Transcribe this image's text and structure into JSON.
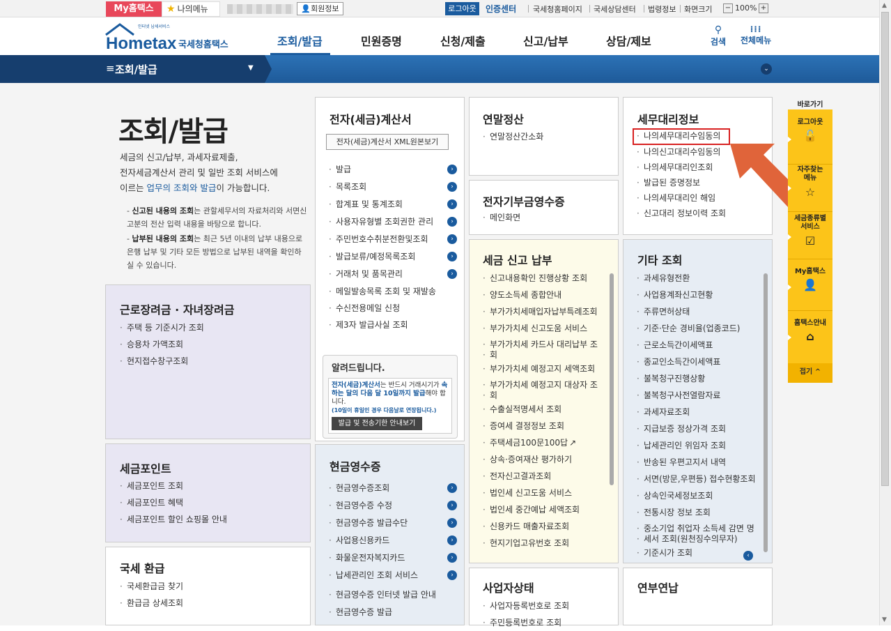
{
  "topbar": {
    "my_hometax": "My홈택스",
    "my_menu": "나의메뉴",
    "user_info": "회원정보",
    "logout": "로그아웃",
    "cert_center": "인증센터",
    "links": [
      "국세청홈페이지",
      "국세상담센터",
      "법령정보"
    ],
    "zoom_label": "화면크기",
    "zoom_minus": "−",
    "zoom_value": "100%",
    "zoom_plus": "+"
  },
  "header": {
    "logo_text": "Hometax",
    "logo_sub": "국세청홈택스",
    "logo_tagline": "인터넷 납세서비스",
    "nav": [
      "조회/발급",
      "민원증명",
      "신청/제출",
      "신고/납부",
      "상담/제보"
    ],
    "search_label": "검색",
    "allmenu_label": "전체메뉴"
  },
  "subbar": {
    "title": "조회/발급"
  },
  "intro": {
    "title": "조회/발급",
    "text1": "세금의 신고/납부, 과세자료제출,",
    "text2": "전자세금계산서 관리 및 일반 조회 서비스에",
    "text3_pre": "이르는 ",
    "text3_hl": "업무의 조회와 발급",
    "text3_post": "이 가능합니다.",
    "note1_bold": "신고된 내용의 조회",
    "note1_rest": "는 관할세무서의 자료처리와 서면신고분의 전산 입력 내용을 바탕으로 합니다.",
    "note2_bold": "납부된 내용의 조회",
    "note2_rest": "는 최근 5년 이내의 납부 내용으로 은행 납부 및 기타 모든 방법으로 납부된 내역을 확인하실 수 있습니다."
  },
  "boxes": {
    "geunro": {
      "title": "근로장려금 · 자녀장려금",
      "items": [
        "주택 등 기준시가 조회",
        "승용차 가액조회",
        "현지접수창구조회"
      ]
    },
    "point": {
      "title": "세금포인트",
      "items": [
        "세금포인트 조회",
        "세금포인트 혜택",
        "세금포인트 할인 쇼핑몰 안내"
      ]
    },
    "refund": {
      "title": "국세 환급",
      "items": [
        "국세환급금 찾기",
        "환급금 상세조회"
      ]
    },
    "einvoice": {
      "title": "전자(세금)계산서",
      "xml_button": "전자(세금)계산서 XML원본보기",
      "items": [
        "발급",
        "목록조회",
        "합계표 및 통계조회",
        "사용자유형별 조회권한 관리",
        "주민번호수취분전환및조회",
        "발급보류/예정목록조회",
        "거래처 및 품목관리",
        "메일발송목록 조회 및 재발송",
        "수신전용메일 신청",
        "제3자 발급사실 조회"
      ]
    },
    "notice": {
      "title": "알려드립니다.",
      "text_bl": "전자(세금)계산서",
      "text_mid": "는 반드시 거래시기가 ",
      "text_bl2": "속하는 달의 다음 달 10일까지 발급",
      "text_end": "해야 합니다.",
      "small": "(10일이 휴일인 경우 다음날로 연장됩니다.)",
      "button": "발급 및 전송기한 안내보기"
    },
    "cash": {
      "title": "현금영수증",
      "items": [
        "현금영수증조회",
        "현금영수증 수정",
        "현금영수증 발급수단",
        "사업용신용카드",
        "화물운전자복지카드",
        "납세관리인 조회 서비스",
        "현금영수증 인터넷 발급 안내",
        "현금영수증 발급"
      ]
    },
    "yearend": {
      "title": "연말정산",
      "items": [
        "연말정산간소화"
      ]
    },
    "donation": {
      "title": "전자기부금영수증",
      "items": [
        "메인화면"
      ]
    },
    "taxpay": {
      "title": "세금 신고 납부",
      "items": [
        "신고내용확인 진행상황 조회",
        "양도소득세 종합안내",
        "부가가치세매입자납부특례조회",
        "부가가치세 신고도움 서비스",
        "부가가치세 카드사 대리납부 조",
        "회",
        "부가가치세 예정고지 세액조회",
        "부가가치세 예정고지 대상자 조",
        "회",
        "수출실적명세서 조회",
        "증여세 결정정보 조회",
        "주택세금100문100답",
        "상속·증여재산 평가하기",
        "전자신고결과조회",
        "법인세 신고도움 서비스",
        "법인세 중간예납 세액조회",
        "신용카드 매출자료조회",
        "현지기업고유번호 조회"
      ]
    },
    "bizstatus": {
      "title": "사업자상태",
      "items": [
        "사업자등록번호로 조회",
        "주민등록번호로 조회"
      ]
    },
    "agent": {
      "title": "세무대리정보",
      "items": [
        "나의세무대리수임동의",
        "나의신고대리수임동의",
        "나의세무대리인조회",
        "발급된 증명정보",
        "나의세무대리인 해임",
        "신고대리 정보이력 조회"
      ]
    },
    "etc": {
      "title": "기타 조회",
      "items": [
        "과세유형전환",
        "사업용계좌신고현황",
        "주류면허상태",
        "기준·단순 경비율(업종코드)",
        "근로소득간이세액표",
        "종교인소득간이세액표",
        "불복청구진행상황",
        "불복청구사전열람자료",
        "과세자료조회",
        "지급보증 정상가격 조회",
        "납세관리인 위임자 조회",
        "반송된 우편고지서 내역",
        "서면(방문,우편등) 접수현황조회",
        "상속인국세정보조회",
        "전통시장 정보 조회",
        "중소기업 취업자 소득세 감면 명",
        "세서 조회(원천징수의무자)",
        "기준시가 조회"
      ]
    },
    "pension": {
      "title": "연부연납"
    }
  },
  "quick": {
    "head": "바로가기",
    "items": [
      "로그아웃",
      "자주찾는 메뉴",
      "세금종류별 서비스",
      "My홈택스",
      "홈택스안내"
    ],
    "close": "접기"
  },
  "colors": {
    "accent": "#1a5b9e",
    "brand_red": "#e8475a",
    "quick_yellow": "#fcc419",
    "arrow": "#e0643a"
  }
}
